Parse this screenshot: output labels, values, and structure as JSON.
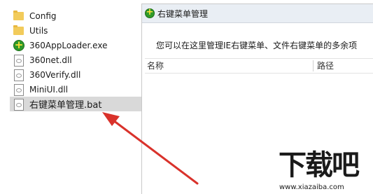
{
  "files": [
    {
      "icon": "folder-icon",
      "label": "Config"
    },
    {
      "icon": "folder-icon",
      "label": "Utils"
    },
    {
      "icon": "app-360-icon",
      "label": "360AppLoader.exe"
    },
    {
      "icon": "dll-file-icon",
      "label": "360net.dll"
    },
    {
      "icon": "dll-file-icon",
      "label": "360Verify.dll"
    },
    {
      "icon": "dll-file-icon",
      "label": "MiniUI.dll"
    },
    {
      "icon": "bat-file-icon",
      "label": "右键菜单管理.bat",
      "selected": true
    }
  ],
  "dialog": {
    "title": "右键菜单管理",
    "description": "您可以在这里管理IE右键菜单、文件右键菜单的多余项",
    "columns": [
      "名称",
      "路径"
    ]
  },
  "annotation": {
    "color": "#d9322b"
  },
  "watermark": {
    "brand": "下载吧",
    "url": "www.xiazaiba.com"
  }
}
